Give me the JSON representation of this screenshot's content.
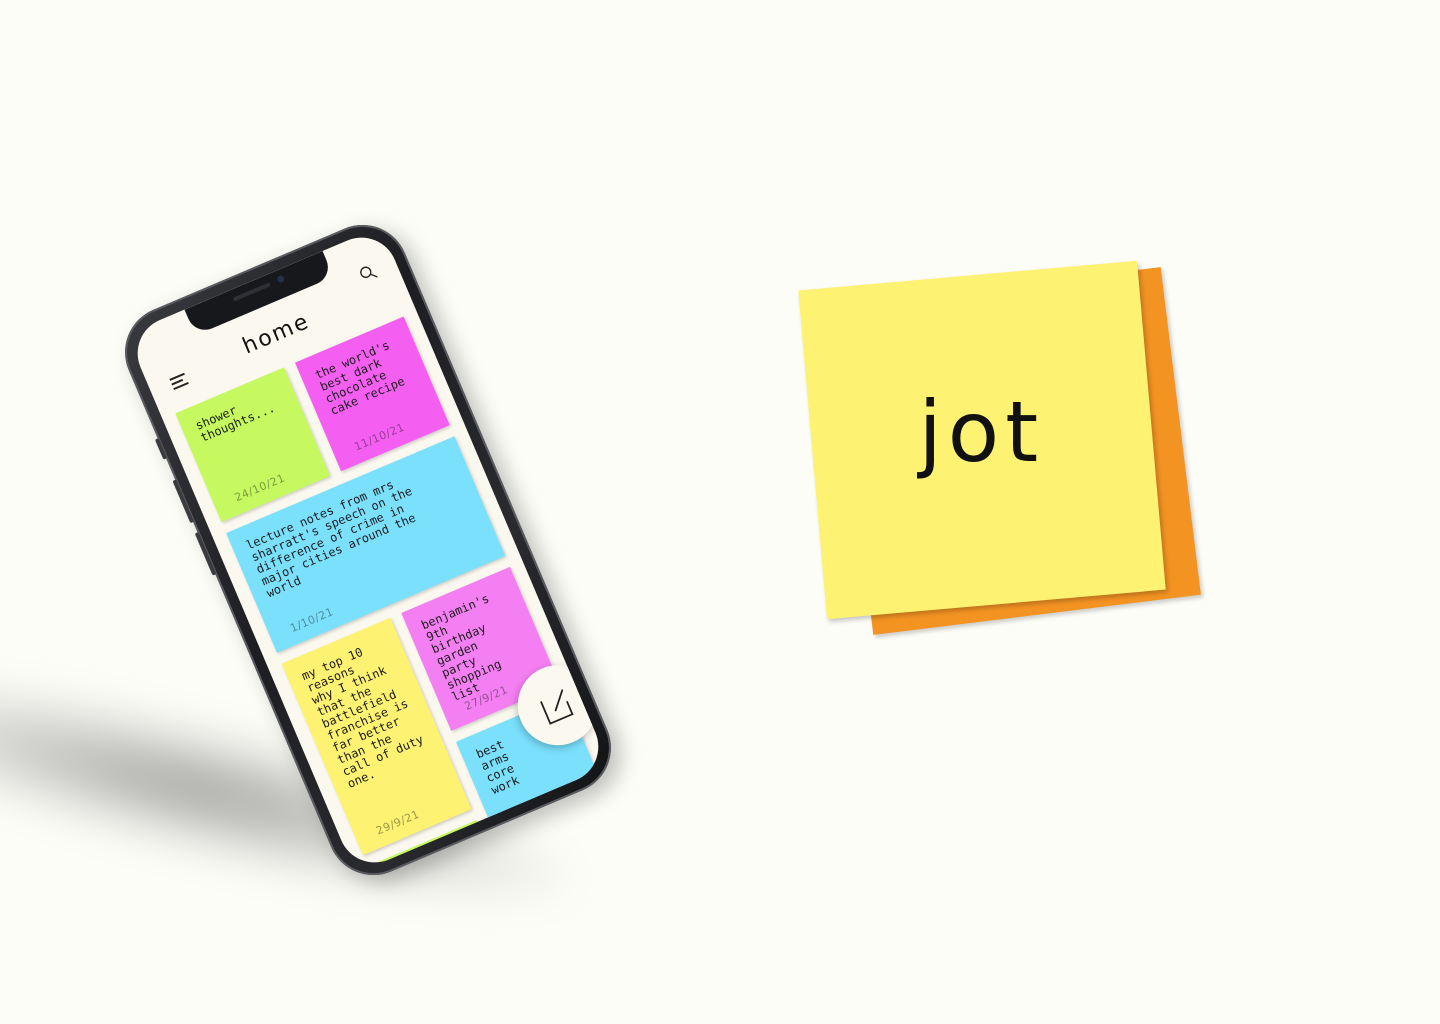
{
  "app": {
    "page_title": "home",
    "logo_text": "jot"
  },
  "icons": {
    "menu": "hamburger-menu-icon",
    "search": "search-icon",
    "compose": "compose-note-icon"
  },
  "colors": {
    "background": "#fdfdf8",
    "screen": "#fbf9ef",
    "note_green": "#c6f95f",
    "note_magenta": "#f45ff2",
    "note_blue": "#7ae0fc",
    "note_pink": "#f47ff2",
    "note_yellow": "#fdf271",
    "logo_yellow": "#fdf271",
    "logo_orange": "#f39322"
  },
  "notes": [
    {
      "text": "shower\nthoughts...",
      "date": "24/10/21",
      "color": "#c6f95f"
    },
    {
      "text": "the world's\nbest dark\nchocolate\ncake recipe",
      "date": "11/10/21",
      "color": "#f45ff2"
    },
    {
      "text": "lecture notes from mrs\nsharratt's speech on the\ndifference of crime in\nmajor cities around the\nworld",
      "date": "1/10/21",
      "color": "#7ae0fc"
    },
    {
      "text": "my top 10\nreasons\nwhy I think\nthat the\nbattlefield\nfranchise is\nfar better\nthan the\ncall of duty\none.",
      "date": "29/9/21",
      "color": "#fdf271"
    },
    {
      "text": "benjamin's\n9th\nbirthday\ngarden\nparty\nshopping\nlist",
      "date": "27/9/21",
      "color": "#f47ff2"
    },
    {
      "text": "best\narms\ncore\nwork",
      "date": "",
      "color": "#7ae0fc"
    },
    {
      "text": "",
      "date": "",
      "color": "#c6f95f"
    }
  ]
}
